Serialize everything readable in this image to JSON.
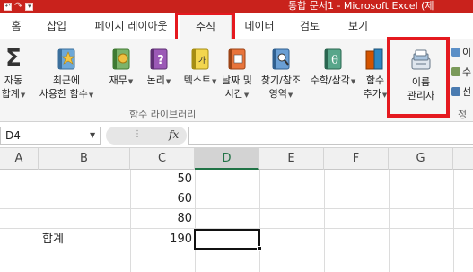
{
  "window": {
    "title": "통합 문서1 - Microsoft Excel (제",
    "accent": "#c9221c",
    "highlight": "#e5191f"
  },
  "qat": {
    "undo_icon": "undo-icon",
    "redo_label": "↷",
    "customize_label": "▾"
  },
  "tabs": [
    {
      "label": "홈"
    },
    {
      "label": "삽입"
    },
    {
      "label": "페이지 레이아웃"
    },
    {
      "label": "수식",
      "active": true
    },
    {
      "label": "데이터"
    },
    {
      "label": "검토"
    },
    {
      "label": "보기"
    }
  ],
  "ribbon": {
    "autosum": {
      "line1": "Σ",
      "line2": "자동",
      "line3": "합계"
    },
    "recent": {
      "line1": "최근에",
      "line2": "사용한 함수"
    },
    "financial": {
      "label": "재무"
    },
    "logical": {
      "label": "논리"
    },
    "text": {
      "label": "텍스트"
    },
    "datetime": {
      "line1": "날짜 및",
      "line2": "시간"
    },
    "lookup": {
      "line1": "찾기/참조",
      "line2": "영역"
    },
    "math": {
      "label": "수학/삼각"
    },
    "more": {
      "line1": "함수",
      "line2": "추가"
    },
    "group_label": "함수 라이브러리",
    "name_manager": {
      "line1": "이름",
      "line2": "관리자"
    },
    "mini1": "이",
    "mini2": "수",
    "mini3": "선",
    "right_group_label": "정의"
  },
  "formula_bar": {
    "name_box": "D4",
    "fx": "fx",
    "value": ""
  },
  "columns": [
    "A",
    "B",
    "C",
    "D",
    "E",
    "F",
    "G"
  ],
  "selected_column": "D",
  "rows": [
    {
      "A": "",
      "B": "",
      "C": "50",
      "D": ""
    },
    {
      "A": "",
      "B": "",
      "C": "60",
      "D": ""
    },
    {
      "A": "",
      "B": "",
      "C": "80",
      "D": ""
    },
    {
      "A": "",
      "B": "합계",
      "C": "190",
      "D": ""
    }
  ],
  "active_cell": "D4"
}
